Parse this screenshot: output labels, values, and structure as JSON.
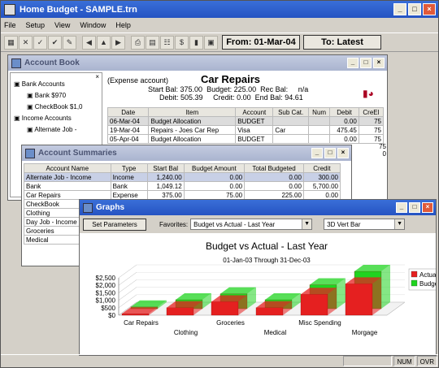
{
  "app": {
    "title": "Home Budget - SAMPLE.trn"
  },
  "menu": [
    "File",
    "Setup",
    "View",
    "Window",
    "Help"
  ],
  "toolbar": {
    "from_label": "From: 01-Mar-04",
    "to_label": "To: Latest"
  },
  "accountBook": {
    "title": "Account Book",
    "tree": [
      {
        "label": "Bank Accounts",
        "indent": 0
      },
      {
        "label": "Bank  $970",
        "indent": 1
      },
      {
        "label": "CheckBook  $1,0",
        "indent": 1
      },
      {
        "label": "Income Accounts",
        "indent": 0
      },
      {
        "label": "Alternate Job -",
        "indent": 1
      }
    ],
    "header": {
      "type": "(Expense account)",
      "name": "Car Repairs",
      "start_bal_label": "Start Bal:",
      "start_bal": "375.00",
      "budget_label": "Budget:",
      "budget": "225.00",
      "rec_bal_label": "Rec Bal:",
      "rec_bal": "n/a",
      "debit_label": "Debit:",
      "debit": "505.39",
      "credit_label": "Credit:",
      "credit": "0.00",
      "end_bal_label": "End Bal:",
      "end_bal": "94.61"
    },
    "columns": [
      "Date",
      "Item",
      "Account",
      "Sub Cat.",
      "Num",
      "Debit",
      "CreEl"
    ],
    "rows": [
      [
        "06-Mar-04",
        "Budget Allocation",
        "BUDGET",
        "",
        "",
        "0.00",
        "75"
      ],
      [
        "19-Mar-04",
        "Repairs - Joes Car Rep",
        "Visa",
        "Car",
        "",
        "475.45",
        "75"
      ],
      [
        "05-Apr-04",
        "Budget Allocation",
        "BUDGET",
        "",
        "",
        "0.00",
        "75"
      ]
    ],
    "right_vals": [
      "75",
      "0"
    ]
  },
  "accountSummaries": {
    "title": "Account Summaries",
    "columns": [
      "Account Name",
      "Type",
      "Start Bal",
      "Budget Amount",
      "Total Budgeted",
      "Credit"
    ],
    "rows": [
      [
        "Alternate Job - Income",
        "Income",
        "1,240.00",
        "0.00",
        "0.00",
        "300.00"
      ],
      [
        "Bank",
        "Bank",
        "1,049.12",
        "0.00",
        "0.00",
        "5,700.00"
      ],
      [
        "Car Repairs",
        "Expense",
        "375.00",
        "75.00",
        "225.00",
        "0.00"
      ],
      [
        "CheckBook",
        "",
        "",
        "",
        "",
        ""
      ],
      [
        "Clothing",
        "",
        "",
        "",
        "",
        ""
      ],
      [
        "Day Job - Income",
        "",
        "",
        "",
        "",
        ""
      ],
      [
        "Groceries",
        "",
        "",
        "",
        "",
        ""
      ],
      [
        "Medical",
        "",
        "",
        "",
        "",
        ""
      ]
    ]
  },
  "graphs": {
    "title": "Graphs",
    "set_params": "Set Parameters",
    "favorites_label": "Favorites:",
    "favorite_value": "Budget vs Actual - Last Year",
    "chart_type_value": "3D Vert Bar"
  },
  "status": {
    "num": "NUM",
    "ovr": "OVR"
  },
  "chart_data": {
    "type": "bar",
    "title": "Budget vs Actual - Last Year",
    "subtitle": "01-Jan-03 Through 31-Dec-03",
    "categories": [
      "Car Repairs",
      "Clothing",
      "Groceries",
      "Medical",
      "Misc Spending",
      "Morgage"
    ],
    "series": [
      {
        "name": "Actual",
        "values": [
          100,
          500,
          900,
          500,
          1400,
          2100
        ],
        "color": "#e52020"
      },
      {
        "name": "Budget",
        "values": [
          120,
          600,
          1000,
          600,
          1600,
          2500
        ],
        "color": "#20d420"
      }
    ],
    "yticks": [
      "$0",
      "$500",
      "$1,000",
      "$1,500",
      "$2,000",
      "$2,500"
    ],
    "ylim": [
      0,
      2500
    ],
    "legend": [
      "Actual",
      "Budget"
    ],
    "legend_placement": "right"
  }
}
